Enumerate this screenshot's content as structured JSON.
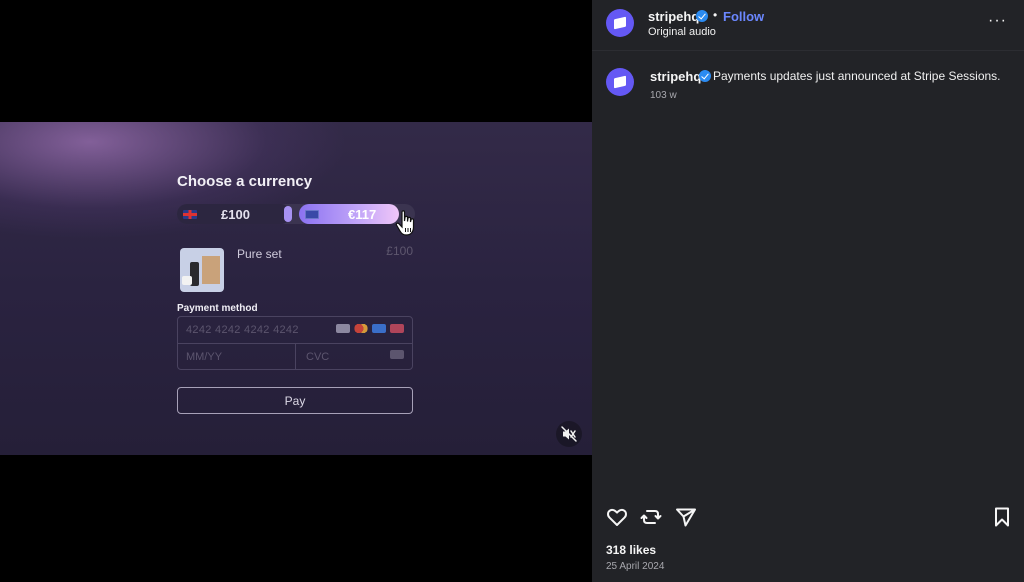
{
  "video": {
    "checkout": {
      "title": "Choose a currency",
      "currency_gbp": "£100",
      "currency_eur": "€117",
      "product_name": "Pure set",
      "product_price": "£100",
      "payment_label": "Payment method",
      "card_number_placeholder": "4242 4242 4242 4242",
      "expiry_placeholder": "MM/YY",
      "cvc_placeholder": "CVC",
      "pay_label": "Pay"
    },
    "mute_icon": "speaker-muted-icon"
  },
  "post": {
    "username": "stripehq",
    "follow_label": "Follow",
    "dot": "•",
    "audio_label": "Original audio",
    "more_label": "···",
    "caption": "Payments updates just announced at Stripe Sessions.",
    "time_ago": "103 w",
    "likes": "318 likes",
    "date": "25 April 2024",
    "brand_color": "#6458f4",
    "follow_color": "#6b87ff",
    "verified_color": "#2b8bf2"
  }
}
